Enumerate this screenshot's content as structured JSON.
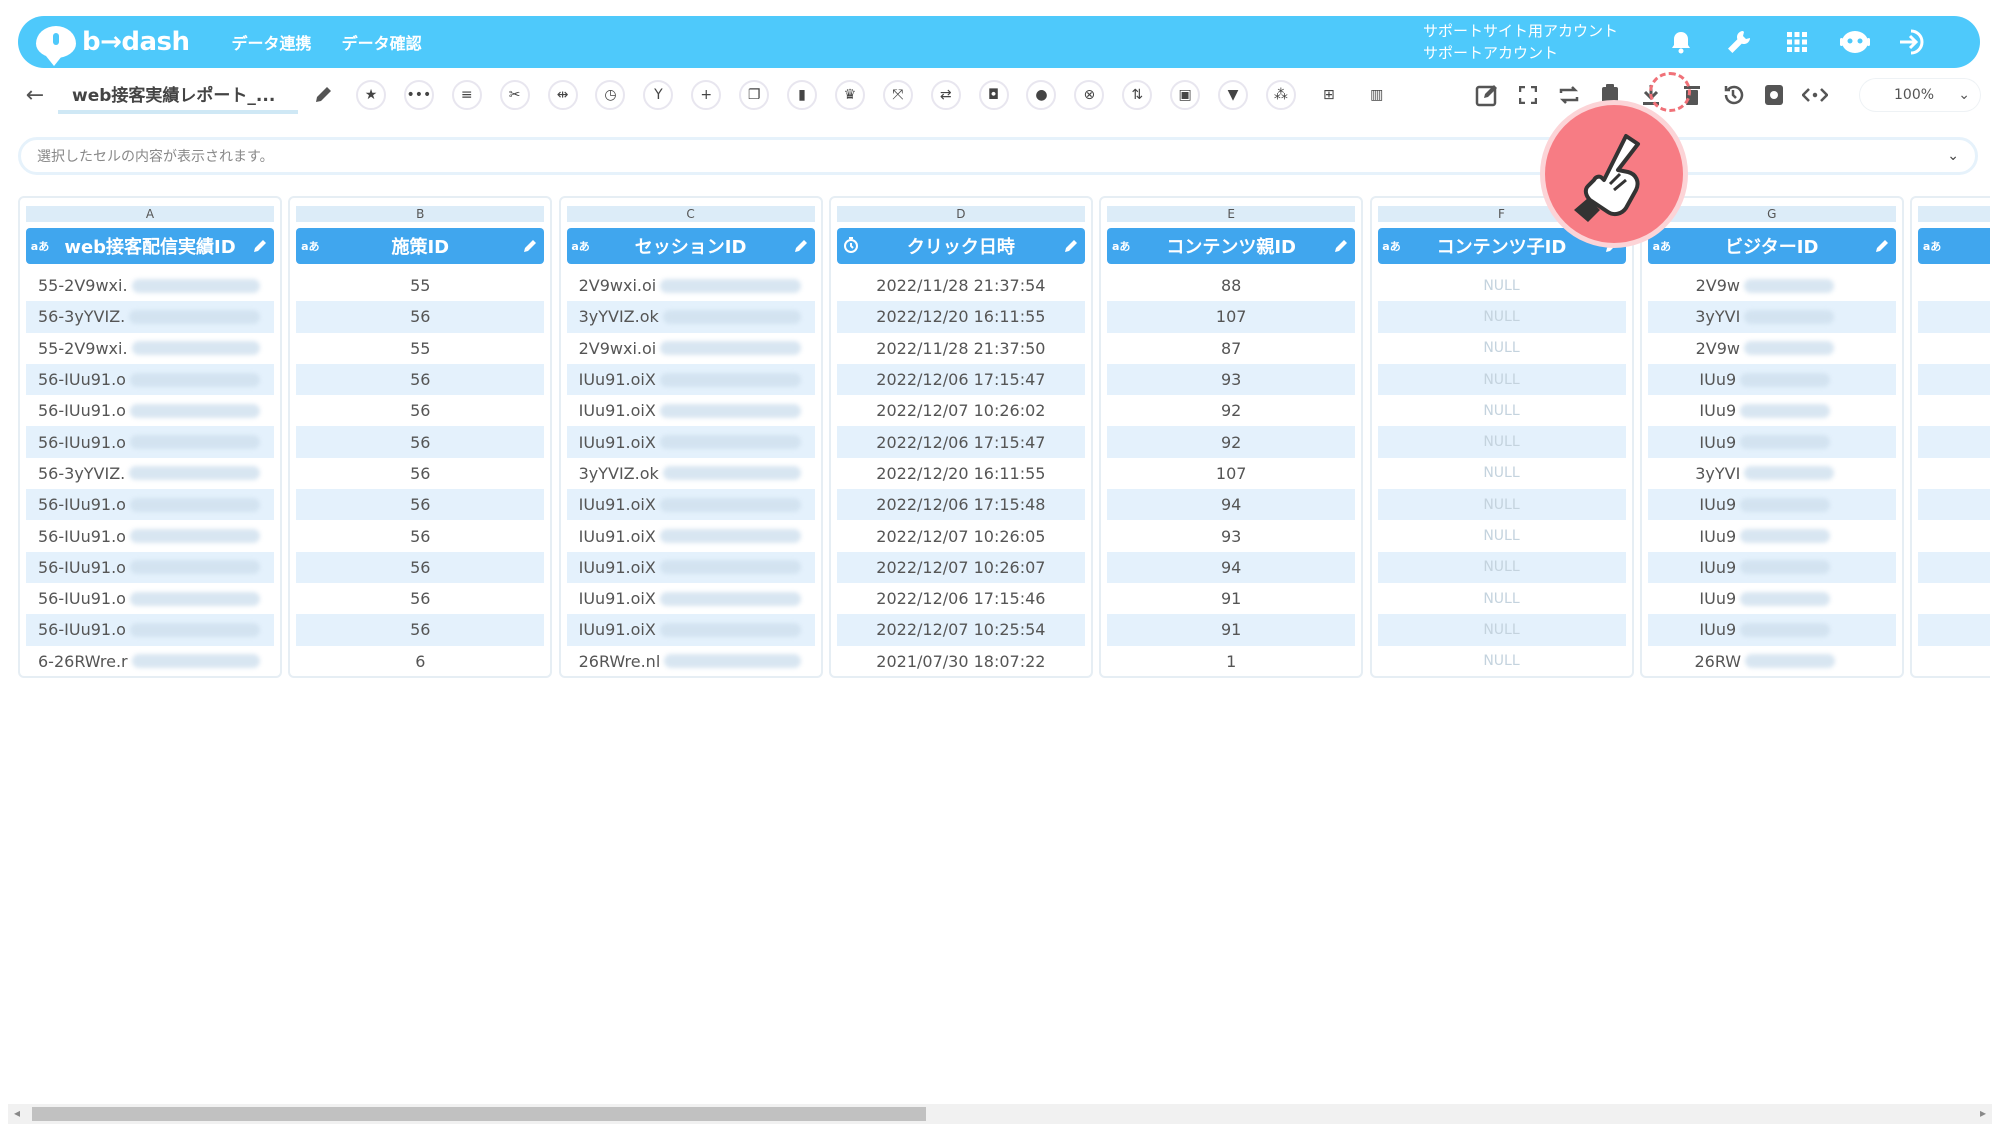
{
  "header": {
    "brand": "b→dash",
    "nav": [
      "データ連携",
      "データ確認"
    ],
    "account_line1": "サポートサイト用アカウント",
    "account_line2": "サポートアカウント",
    "icons": [
      "bell-icon",
      "wrench-icon",
      "grid-icon",
      "chat-bot-icon",
      "logout-icon"
    ]
  },
  "toolbar": {
    "back_label": "←",
    "report_title": "web接客実績レポート_...",
    "zoom": "100%",
    "tools": [
      "star-icon",
      "more-icon",
      "list-icon",
      "scissors-icon",
      "split-icon",
      "timer-icon",
      "branch-icon",
      "plus-icon",
      "copy-icon",
      "trash-icon",
      "crown-icon",
      "expand-icon",
      "repeat-icon",
      "lock-icon",
      "bag-icon",
      "close-icon",
      "swap-icon",
      "frame-icon",
      "filter-icon",
      "grid-dots-icon",
      "table-icon",
      "columns-icon"
    ],
    "right_tools": [
      "edit-icon",
      "fullscreen-icon",
      "refresh-icon",
      "clipboard-icon",
      "download-icon",
      "trash-icon",
      "history-icon",
      "settings-icon",
      "code-icon"
    ]
  },
  "cellbar": {
    "placeholder": "選択したセルの内容が表示されます。"
  },
  "columns": [
    {
      "letter": "A",
      "type": "aあ",
      "name": "web接客配信実績ID",
      "cells": [
        "55-2V9wxi.",
        "56-3yYVIZ.",
        "55-2V9wxi.",
        "56-IUu91.o",
        "56-IUu91.o",
        "56-IUu91.o",
        "56-3yYVIZ.",
        "56-IUu91.o",
        "56-IUu91.o",
        "56-IUu91.o",
        "56-IUu91.o",
        "56-IUu91.o",
        "6-26RWre.r"
      ]
    },
    {
      "letter": "B",
      "type": "aあ",
      "name": "施策ID",
      "cells": [
        "55",
        "56",
        "55",
        "56",
        "56",
        "56",
        "56",
        "56",
        "56",
        "56",
        "56",
        "56",
        "6"
      ]
    },
    {
      "letter": "C",
      "type": "aあ",
      "name": "セッションID",
      "cells": [
        "2V9wxi.oi",
        "3yYVIZ.ok",
        "2V9wxi.oi",
        "IUu91.oiX",
        "IUu91.oiX",
        "IUu91.oiX",
        "3yYVIZ.ok",
        "IUu91.oiX",
        "IUu91.oiX",
        "IUu91.oiX",
        "IUu91.oiX",
        "IUu91.oiX",
        "26RWre.nl"
      ]
    },
    {
      "letter": "D",
      "type": "clock",
      "name": "クリック日時",
      "cells": [
        "2022/11/28 21:37:54",
        "2022/12/20 16:11:55",
        "2022/11/28 21:37:50",
        "2022/12/06 17:15:47",
        "2022/12/07 10:26:02",
        "2022/12/06 17:15:47",
        "2022/12/20 16:11:55",
        "2022/12/06 17:15:48",
        "2022/12/07 10:26:05",
        "2022/12/07 10:26:07",
        "2022/12/06 17:15:46",
        "2022/12/07 10:25:54",
        "2021/07/30 18:07:22"
      ]
    },
    {
      "letter": "E",
      "type": "aあ",
      "name": "コンテンツ親ID",
      "cells": [
        "88",
        "107",
        "87",
        "93",
        "92",
        "92",
        "107",
        "94",
        "93",
        "94",
        "91",
        "91",
        "1"
      ]
    },
    {
      "letter": "F",
      "type": "aあ",
      "name": "コンテンツ子ID",
      "cells": [
        "NULL",
        "NULL",
        "NULL",
        "NULL",
        "NULL",
        "NULL",
        "NULL",
        "NULL",
        "NULL",
        "NULL",
        "NULL",
        "NULL",
        "NULL"
      ]
    },
    {
      "letter": "G",
      "type": "aあ",
      "name": "ビジターID",
      "cells": [
        "2V9w",
        "3yYVI",
        "2V9w",
        "IUu9",
        "IUu9",
        "IUu9",
        "3yYVI",
        "IUu9",
        "IUu9",
        "IUu9",
        "IUu9",
        "IUu9",
        "26RW"
      ]
    },
    {
      "letter": "",
      "type": "aあ",
      "name": "",
      "cells": [
        "",
        "",
        "",
        "",
        "",
        "",
        "",
        "",
        "",
        "",
        "",
        "",
        ""
      ]
    }
  ]
}
